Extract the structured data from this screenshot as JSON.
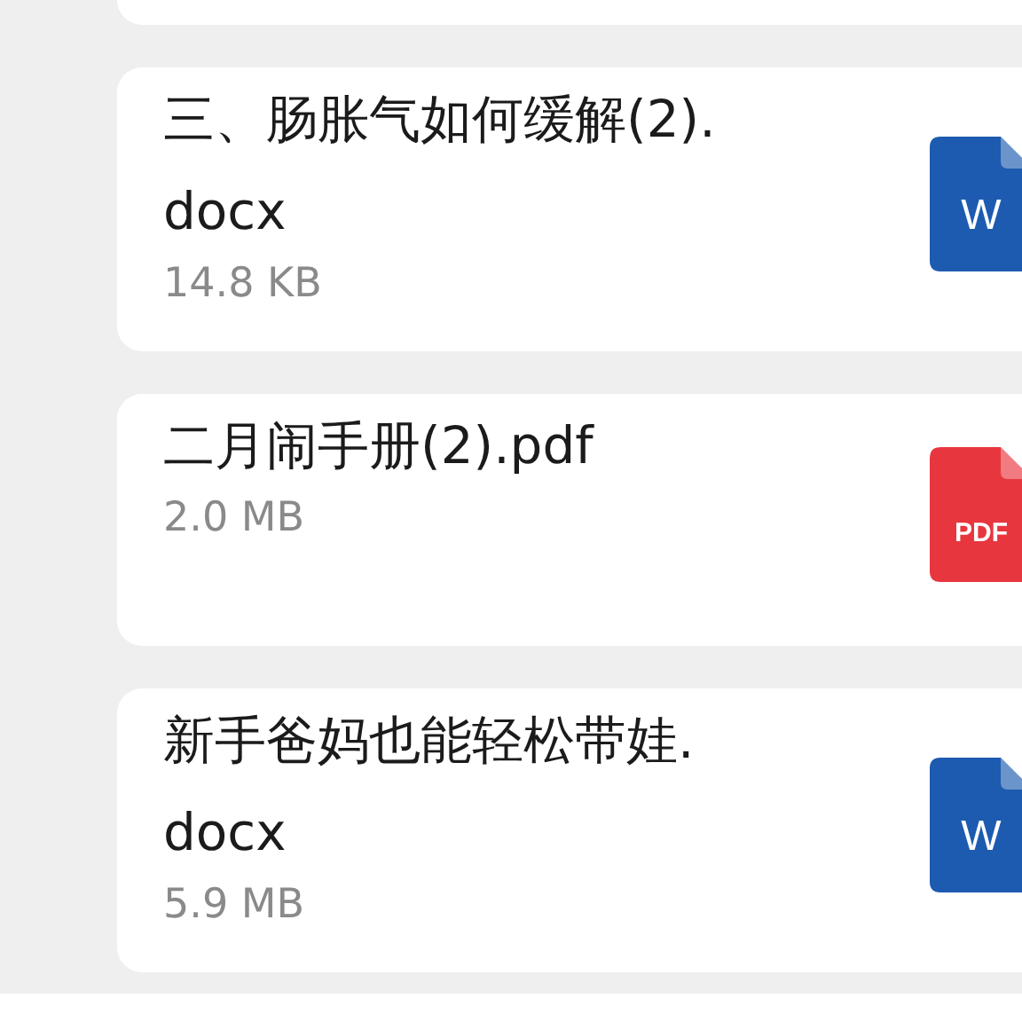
{
  "files": [
    {
      "name": "三、肠胀气如何缓解(2).\ndocx",
      "size": "14.8 KB",
      "kind": "word",
      "icon_label": "W"
    },
    {
      "name": "二月闹手册(2).pdf",
      "size": "2.0 MB",
      "kind": "pdf",
      "icon_label": "PDF"
    },
    {
      "name": "新手爸妈也能轻松带娃.\ndocx",
      "size": "5.9 MB",
      "kind": "word",
      "icon_label": "W"
    }
  ]
}
